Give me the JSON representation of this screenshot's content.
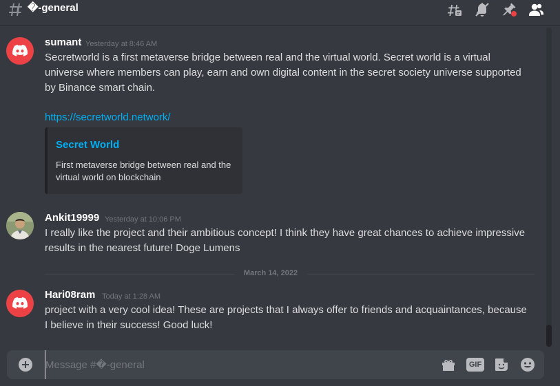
{
  "header": {
    "channel_name": "\u0000-general",
    "channel_name_display": "�-general"
  },
  "messages": [
    {
      "username": "sumant",
      "timestamp": "Yesterday at 8:46 AM",
      "text": "Secretworld is a first metaverse bridge between real and the virtual world. Secret world is a virtual universe where members can play, earn and own digital content in the secret society universe supported by Binance smart chain.",
      "link": "https://secretworld.network/",
      "embed": {
        "title": "Secret World",
        "description": "First metaverse bridge between real and the virtual world on blockchain"
      }
    },
    {
      "username": "Ankit19999",
      "timestamp": "Yesterday at 10:06 PM",
      "text": "I really like the project and their ambitious concept! I think they have great chances to achieve impressive results in the nearest future!  Doge Lumens"
    },
    {
      "username": "Hari08ram",
      "timestamp": "Today at 1:28 AM",
      "text": "project with a very cool idea! These are projects that I always offer to friends and acquaintances, because I believe in their success! Good luck!"
    }
  ],
  "date_divider": "March 14, 2022",
  "composer": {
    "placeholder": "Message #�-general",
    "gif_label": "GIF"
  },
  "colors": {
    "background": "#36393f",
    "link": "#00aff4",
    "discord_red": "#ed4245",
    "notification_dot": "#ed4245"
  },
  "icons": [
    "threads-icon",
    "mute-bell-icon",
    "pin-icon",
    "members-icon",
    "add-attachment-icon",
    "gift-icon",
    "gif-icon",
    "sticker-icon",
    "emoji-icon",
    "discord-logo-icon"
  ]
}
